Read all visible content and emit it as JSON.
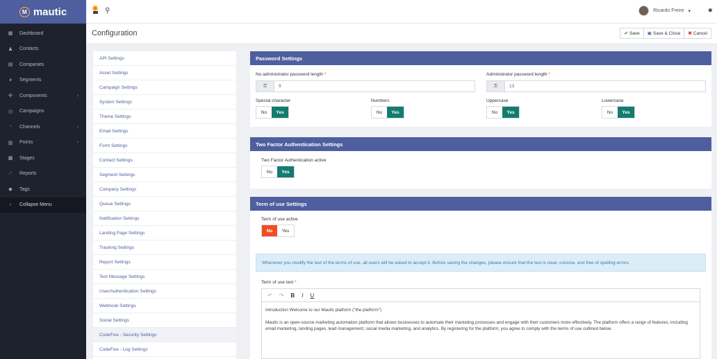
{
  "brand": {
    "name": "mautic",
    "logo_letter": "M"
  },
  "sidebar": {
    "items": [
      {
        "label": "Dashboard",
        "icon": "grid-icon",
        "glyph": "▦",
        "chevron": false
      },
      {
        "label": "Contacts",
        "icon": "user-icon",
        "glyph": "♟",
        "chevron": false
      },
      {
        "label": "Companies",
        "icon": "building-icon",
        "glyph": "▤",
        "chevron": false
      },
      {
        "label": "Segments",
        "icon": "pie-chart-icon",
        "glyph": "◕",
        "chevron": false
      },
      {
        "label": "Components",
        "icon": "puzzle-icon",
        "glyph": "✣",
        "chevron": true
      },
      {
        "label": "Campaigns",
        "icon": "clock-icon",
        "glyph": "◷",
        "chevron": false
      },
      {
        "label": "Channels",
        "icon": "rss-icon",
        "glyph": "◝",
        "chevron": true
      },
      {
        "label": "Points",
        "icon": "calculator-icon",
        "glyph": "▥",
        "chevron": true
      },
      {
        "label": "Stages",
        "icon": "stages-icon",
        "glyph": "▩",
        "chevron": false
      },
      {
        "label": "Reports",
        "icon": "line-chart-icon",
        "glyph": "⟋",
        "chevron": false
      },
      {
        "label": "Tags",
        "icon": "tag-icon",
        "glyph": "◆",
        "chevron": false
      },
      {
        "label": "Collapse Menu",
        "icon": "chevron-left-icon",
        "glyph": "‹",
        "chevron": false
      }
    ]
  },
  "topbar": {
    "user_name": "Ricardo Freire",
    "user_caret": "▾",
    "search_glyph": "⚲",
    "gear_glyph": "✹"
  },
  "page": {
    "title": "Configuration",
    "save_label": "Save",
    "save_close_label": "Save & Close",
    "cancel_label": "Cancel"
  },
  "settings_list": [
    "API Settings",
    "Asset Settings",
    "Campaign Settings",
    "System Settings",
    "Theme Settings",
    "Email Settings",
    "Form Settings",
    "Contact Settings",
    "Segment Settings",
    "Company Settings",
    "Queue Settings",
    "Notification Settings",
    "Landing Page Settings",
    "Tracking Settings",
    "Report Settings",
    "Text Message Settings",
    "User/Authentication Settings",
    "Webhook Settings",
    "Social Settings",
    "CodeFive - Security Settings",
    "CodeFive - Log Settings"
  ],
  "active_setting": "CodeFive - Security Settings",
  "password": {
    "heading": "Password Settings",
    "no_admin_label": "No administrator password length",
    "no_admin_value": "9",
    "admin_label": "Administrator password length",
    "admin_value": "13",
    "required_mark": "*",
    "key_glyph": "⚿",
    "toggles": [
      {
        "label": "Special character",
        "value": "Yes"
      },
      {
        "label": "Numbers",
        "value": "Yes"
      },
      {
        "label": "Uppercase",
        "value": "Yes"
      },
      {
        "label": "Lowercase",
        "value": "Yes"
      }
    ]
  },
  "toggle_text": {
    "no": "No",
    "yes": "Yes"
  },
  "two_factor": {
    "heading": "Two Factor Authentication Settings",
    "active_label": "Two Factor Authentication active",
    "value": "Yes"
  },
  "terms": {
    "heading": "Term of use Settings",
    "active_label": "Term of use active",
    "value": "No",
    "info": "Whenever you modify the text of the terms of use, all users will be asked to accept it. Before saving the changes, please ensure that the text is clear, concise, and free of spelling errors.",
    "text_label": "Term of use text",
    "editor_tools": {
      "undo": "↶",
      "redo": "↷",
      "bold": "B",
      "italic": "I",
      "underline": "U"
    },
    "paragraph1": "Introduction Welcome to our Mautic platform (\"the platform\")",
    "paragraph2": "Mautic is an open-source marketing automation platform that allows businesses to automate their marketing processes and engage with their customers more effectively. The platform offers a range of features, including email marketing, landing pages, lead management, social media marketing, and analytics. By registering for the platform, you agree to comply with the terms of use outlined below."
  },
  "colors": {
    "sidebar_bg": "#1e222d",
    "brand_bg": "#4e5e9e",
    "panel_header": "#4e5e9e",
    "toggle_yes": "#147c6e",
    "toggle_no": "#f24d22",
    "info_bg": "#dcedf7"
  }
}
